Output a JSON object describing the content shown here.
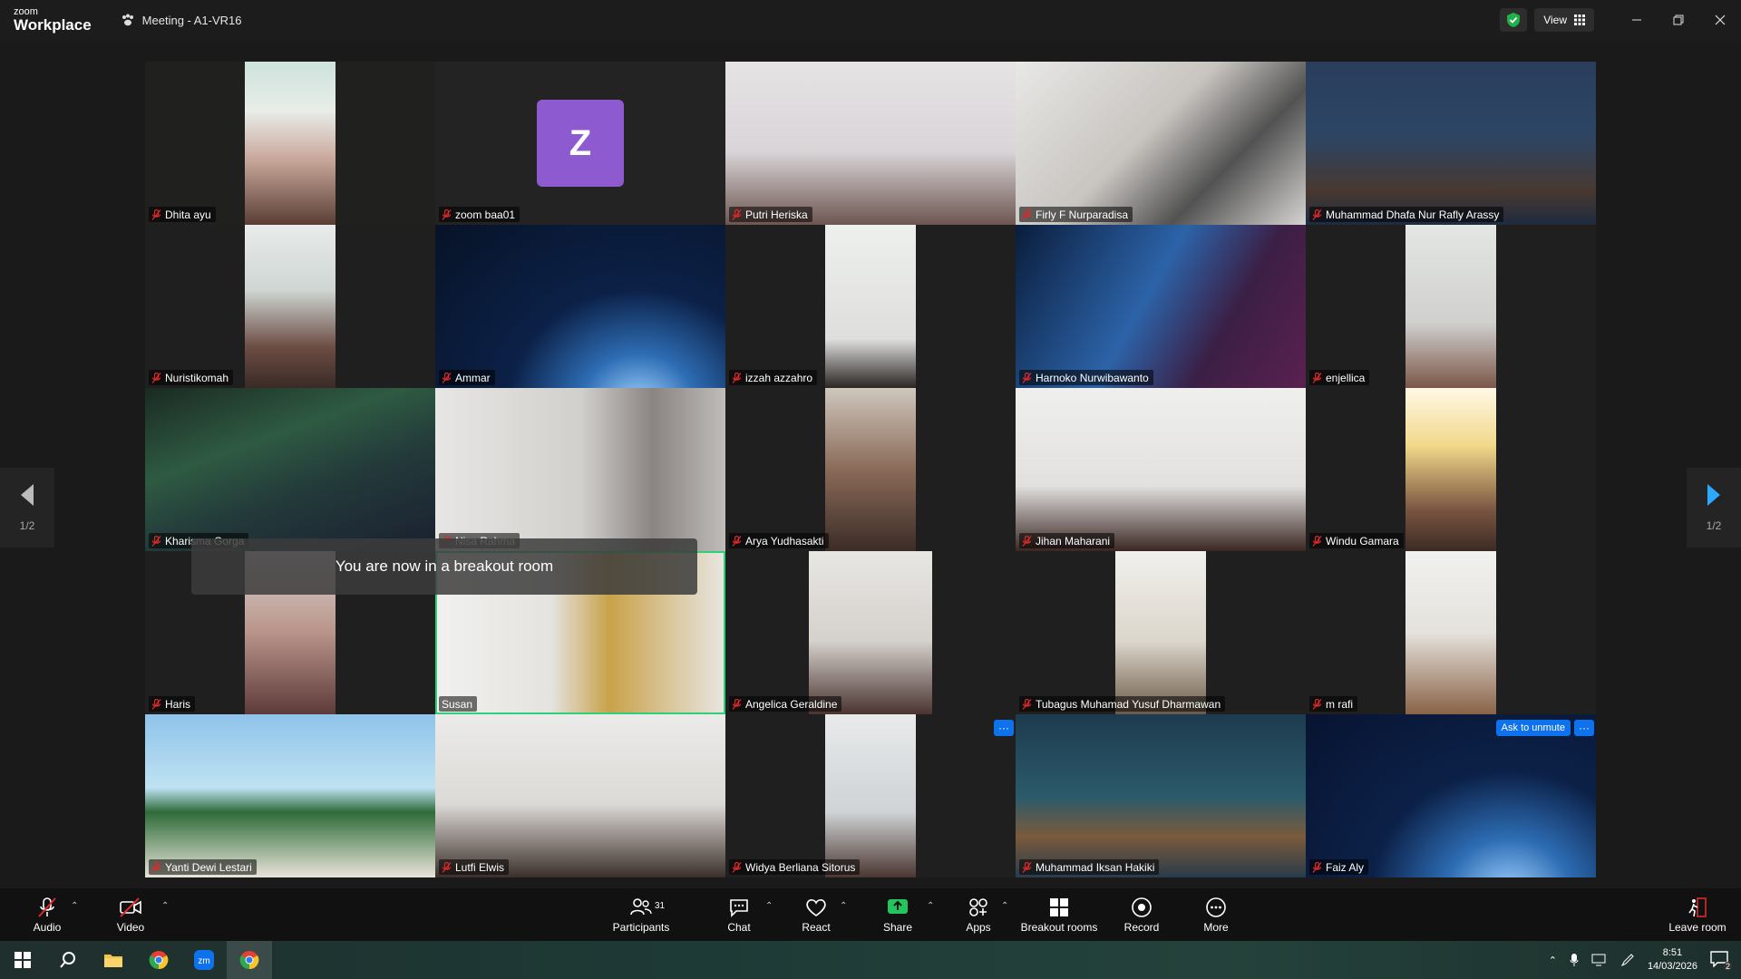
{
  "app": {
    "logo_top": "zoom",
    "logo_bottom": "Workplace",
    "meeting_title": "Meeting - A1-VR16",
    "view_label": "View"
  },
  "toast": "You are now in a breakout room",
  "pager": {
    "left": "1/2",
    "right": "1/2"
  },
  "tiles": [
    {
      "name": "Dhita ayu"
    },
    {
      "name": "zoom baa01",
      "avatar": "Z"
    },
    {
      "name": "Putri Heriska"
    },
    {
      "name": "Firly F Nurparadisa"
    },
    {
      "name": "Muhammad Dhafa Nur Rafly Arassy"
    },
    {
      "name": "Nuristikomah"
    },
    {
      "name": "Ammar"
    },
    {
      "name": "izzah azzahro"
    },
    {
      "name": "Harnoko Nurwibawanto"
    },
    {
      "name": "enjellica"
    },
    {
      "name": "Kharisma Gorga"
    },
    {
      "name": "Nisa Rahma"
    },
    {
      "name": "Arya Yudhasakti"
    },
    {
      "name": "Jihan Maharani"
    },
    {
      "name": "Windu Gamara"
    },
    {
      "name": "Haris"
    },
    {
      "name": "Susan"
    },
    {
      "name": "Angelica Geraldine"
    },
    {
      "name": "Tubagus Muhamad Yusuf Dharmawan"
    },
    {
      "name": "m rafi"
    },
    {
      "name": "Yanti Dewi Lestari"
    },
    {
      "name": "Lutfi Elwis"
    },
    {
      "name": "Widya Berliana Sitorus"
    },
    {
      "name": "Muhammad Iksan Hakiki"
    },
    {
      "name": "Faiz Aly"
    }
  ],
  "ask_to_unmute": "Ask to unmute",
  "more_dots": "···",
  "toolbar": {
    "audio": "Audio",
    "video": "Video",
    "participants": "Participants",
    "participants_count": "31",
    "chat": "Chat",
    "react": "React",
    "share": "Share",
    "apps": "Apps",
    "breakout": "Breakout rooms",
    "record": "Record",
    "more": "More",
    "leave": "Leave room"
  },
  "taskbar": {
    "time": "8:51",
    "date": "14/03/2026",
    "notif_count": "2"
  },
  "colors": {
    "accent": "#0e72ed",
    "active_speaker": "#2fd07a",
    "avatar": "#8d5ad0",
    "mic_off": "#e02828"
  }
}
